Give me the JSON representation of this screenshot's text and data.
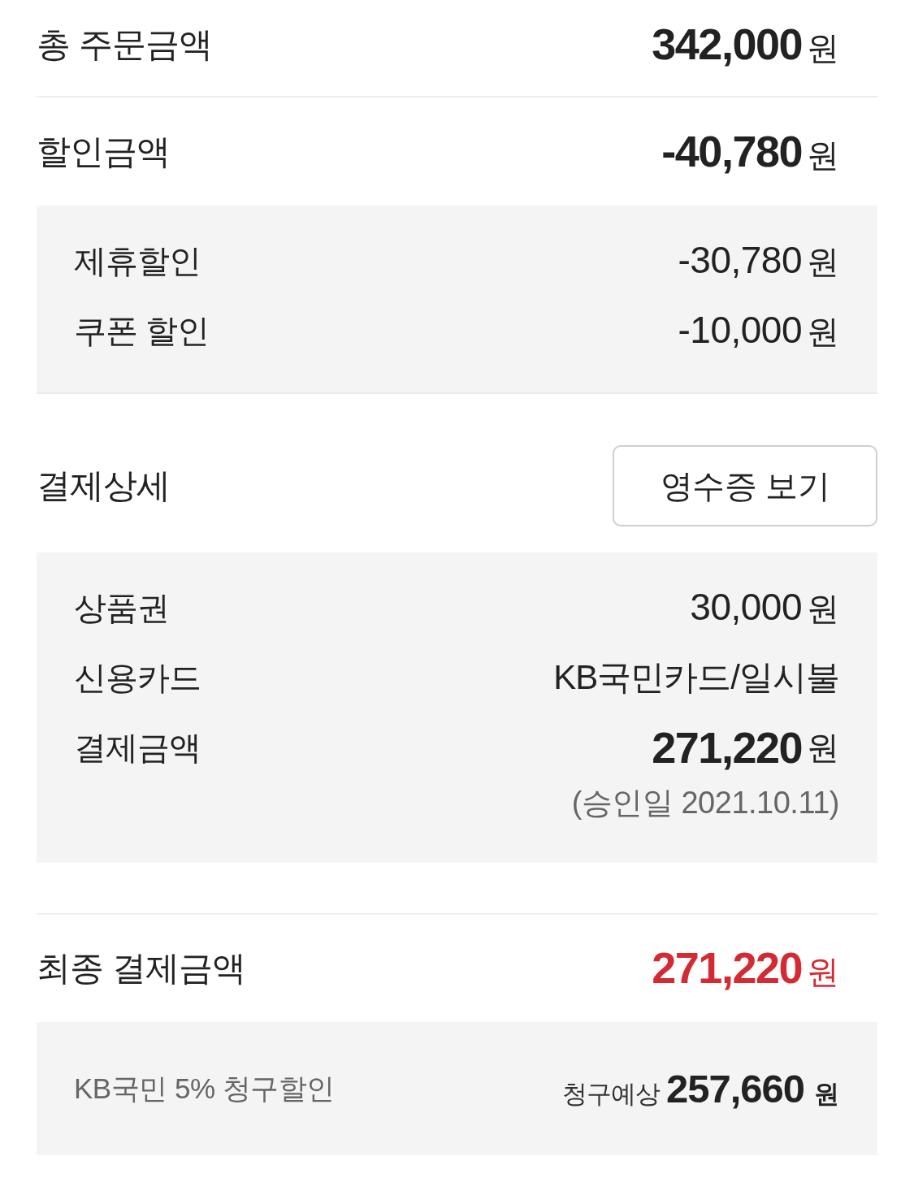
{
  "order_total": {
    "label": "총 주문금액",
    "amount": "342,000",
    "unit": "원"
  },
  "discount": {
    "label": "할인금액",
    "amount": "-40,780",
    "unit": "원",
    "items": [
      {
        "label": "제휴할인",
        "amount": "-30,780",
        "unit": "원"
      },
      {
        "label": "쿠폰 할인",
        "amount": "-10,000",
        "unit": "원"
      }
    ]
  },
  "payment_details": {
    "title": "결제상세",
    "receipt_button": "영수증 보기",
    "items": [
      {
        "kind": "amount",
        "label": "상품권",
        "amount": "30,000",
        "unit": "원"
      },
      {
        "kind": "text",
        "label": "신용카드",
        "value": "KB국민카드/일시불"
      },
      {
        "kind": "total",
        "label": "결제금액",
        "amount": "271,220",
        "unit": "원",
        "note": "(승인일 2021.10.11)"
      }
    ]
  },
  "final_payment": {
    "label": "최종 결제금액",
    "amount": "271,220",
    "unit": "원"
  },
  "card_benefit": {
    "label": "KB국민 5% 청구할인",
    "estimate_label": "청구예상",
    "amount": "257,660",
    "unit": "원"
  }
}
